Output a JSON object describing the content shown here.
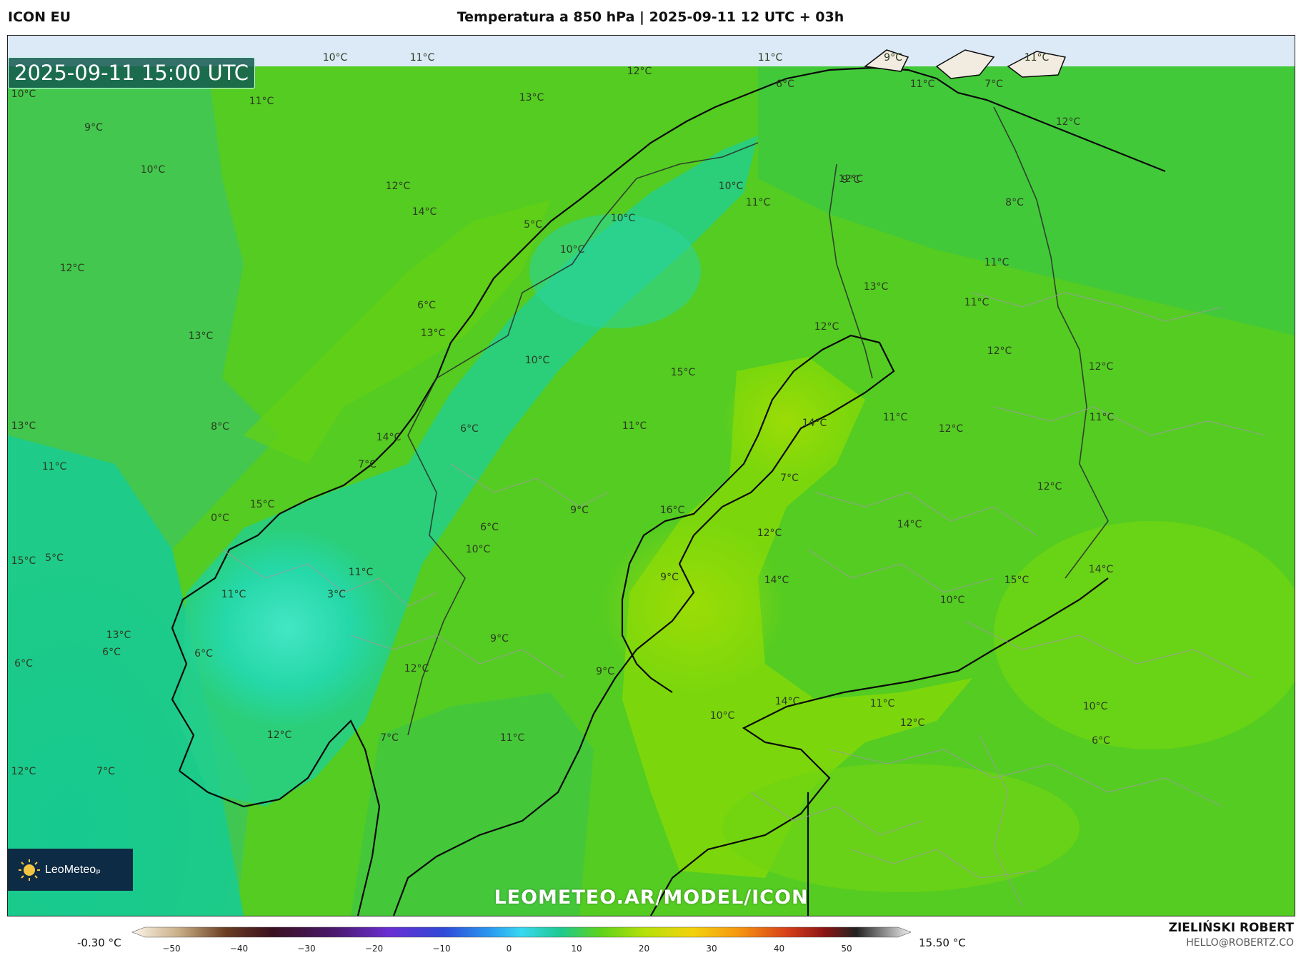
{
  "header": {
    "model": "ICON EU",
    "title": "Temperatura a 850 hPa | 2025-09-11 12 UTC + 03h"
  },
  "map": {
    "valid_time": "2025-09-11 15:00 UTC",
    "watermark": "LEOMETEO.AR/MODEL/ICON",
    "labels": [
      "10°C",
      "11°C",
      "11°C",
      "9°C",
      "11°C",
      "10°C",
      "11°C",
      "9°C",
      "10°C",
      "12°C",
      "13°C",
      "11°C",
      "6°C",
      "7°C",
      "12°C",
      "12°C",
      "12°C",
      "14°C",
      "9°C",
      "10°C",
      "11°C",
      "8°C",
      "5°C",
      "10°C",
      "10°C",
      "11°C",
      "12°C",
      "13°C",
      "11°C",
      "12°C",
      "13°C",
      "13°C",
      "6°C",
      "10°C",
      "12°C",
      "15°C",
      "12°C",
      "13°C",
      "8°C",
      "14°C",
      "6°C",
      "11°C",
      "14°C",
      "11°C",
      "12°C",
      "11°C",
      "11°C",
      "7°C",
      "7°C",
      "12°C",
      "15°C",
      "0°C",
      "9°C",
      "16°C",
      "14°C",
      "12°C",
      "15°C",
      "5°C",
      "6°C",
      "10°C",
      "11°C",
      "9°C",
      "14°C",
      "15°C",
      "14°C",
      "11°C",
      "3°C",
      "10°C",
      "13°C",
      "6°C",
      "6°C",
      "6°C",
      "9°C",
      "12°C",
      "9°C",
      "10°C",
      "14°C",
      "11°C",
      "12°C",
      "10°C",
      "12°C",
      "7°C",
      "7°C",
      "11°C",
      "12°C",
      "6°C",
      "11°C"
    ],
    "colors": {
      "warm_land": "#5cd21c",
      "warmest": "#8fda0a",
      "mid_green": "#38c43a",
      "teal": "#1dc98a",
      "cool": "#2ddfb3",
      "top_strip": "#dce9f6"
    }
  },
  "logo": {
    "name": "LeoMeteo",
    "suffix": "jp",
    "icon": "sun-icon"
  },
  "colorbar": {
    "min_label": "-0.30 °C",
    "max_label": "15.50 °C",
    "ticks": [
      "−50",
      "−40",
      "−30",
      "−20",
      "−10",
      "0",
      "10",
      "20",
      "30",
      "40",
      "50"
    ]
  },
  "author": {
    "name": "ZIELIŃSKI ROBERT",
    "email": "HELLO@ROBERTZ.CO"
  }
}
